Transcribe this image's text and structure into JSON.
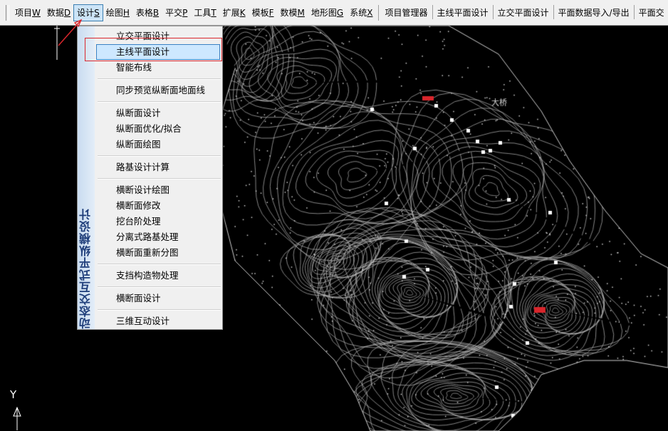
{
  "menubar": {
    "items": [
      {
        "text": "项目",
        "hotkey": "W"
      },
      {
        "text": "数据",
        "hotkey": "D"
      },
      {
        "text": "设计",
        "hotkey": "S"
      },
      {
        "text": "绘图",
        "hotkey": "H"
      },
      {
        "text": "表格",
        "hotkey": "B"
      },
      {
        "text": "平交",
        "hotkey": "P"
      },
      {
        "text": "工具",
        "hotkey": "T"
      },
      {
        "text": "扩展",
        "hotkey": "K"
      },
      {
        "text": "模板",
        "hotkey": "F"
      },
      {
        "text": "数模",
        "hotkey": "M"
      },
      {
        "text": "地形图",
        "hotkey": "G"
      },
      {
        "text": "系统",
        "hotkey": "X"
      }
    ],
    "tools": [
      "项目管理器",
      "主线平面设计",
      "立交平面设计",
      "平面数据导入/导出",
      "平面交"
    ]
  },
  "dropdown": {
    "sidebar_title": "动态交互式平纵横设计",
    "groups": [
      [
        "立交平面设计",
        "主线平面设计",
        "智能布线"
      ],
      [
        "同步预览纵断面地面线"
      ],
      [
        "纵断面设计",
        "纵断面优化/拟合",
        "纵断面绘图"
      ],
      [
        "路基设计计算"
      ],
      [
        "横断设计绘图",
        "横断面修改",
        "挖台阶处理",
        "分离式路基处理",
        "横断面重新分图"
      ],
      [
        "支挡构造物处理"
      ],
      [
        "横断面设计"
      ],
      [
        "三维互动设计"
      ]
    ],
    "highlighted": "主线平面设计"
  },
  "canvas": {
    "map_label": "大桥",
    "ucs_axis": "Y"
  },
  "colors": {
    "accent": "#d9262c",
    "contour": "#bdbdbd",
    "menu_bg": "#f0f0f0"
  }
}
